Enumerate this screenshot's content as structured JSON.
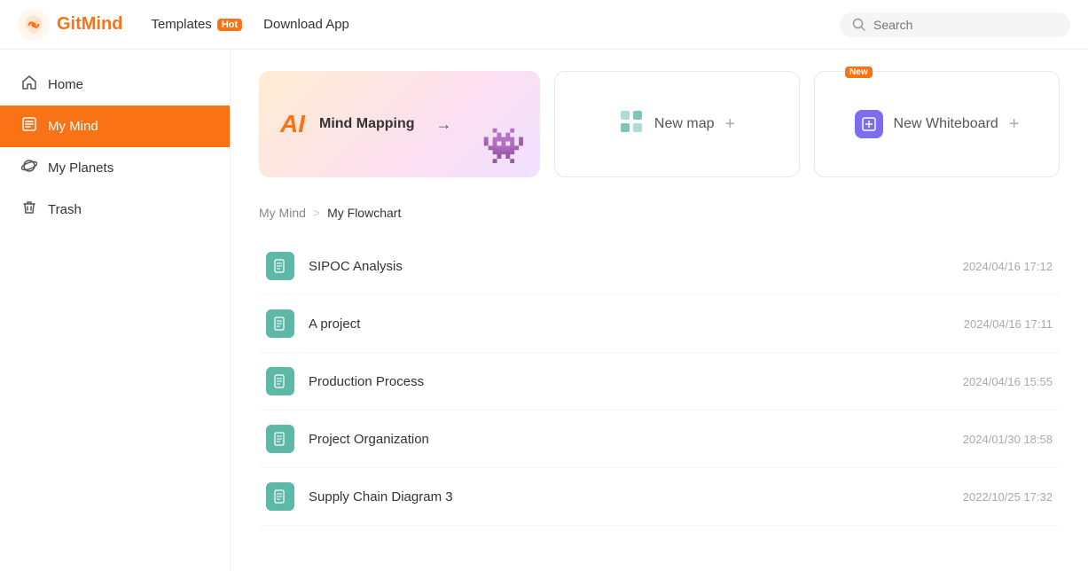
{
  "header": {
    "logo_text": "GitMind",
    "nav": {
      "templates_label": "Templates",
      "templates_badge": "Hot",
      "download_label": "Download App"
    },
    "search_placeholder": "Search"
  },
  "sidebar": {
    "items": [
      {
        "id": "home",
        "label": "Home",
        "icon": "🏠",
        "active": false
      },
      {
        "id": "my-mind",
        "label": "My Mind",
        "icon": "📄",
        "active": true
      },
      {
        "id": "my-planets",
        "label": "My Planets",
        "icon": "🎯",
        "active": false
      },
      {
        "id": "trash",
        "label": "Trash",
        "icon": "🗑",
        "active": false
      }
    ]
  },
  "quick_actions": {
    "mind_mapping": {
      "ai_label": "AI",
      "label": "Mind Mapping",
      "arrow": "→",
      "emoji": "👻"
    },
    "new_map": {
      "label": "New map",
      "plus": "+"
    },
    "new_whiteboard": {
      "label": "New Whiteboard",
      "badge": "New",
      "plus": "+"
    }
  },
  "breadcrumb": {
    "parent": "My Mind",
    "separator": ">",
    "current": "My Flowchart"
  },
  "files": [
    {
      "name": "SIPOC Analysis",
      "date": "2024/04/16 17:12"
    },
    {
      "name": "A project",
      "date": "2024/04/16 17:11"
    },
    {
      "name": "Production Process",
      "date": "2024/04/16 15:55"
    },
    {
      "name": "Project Organization",
      "date": "2024/01/30 18:58"
    },
    {
      "name": "Supply Chain Diagram 3",
      "date": "2022/10/25 17:32"
    }
  ]
}
